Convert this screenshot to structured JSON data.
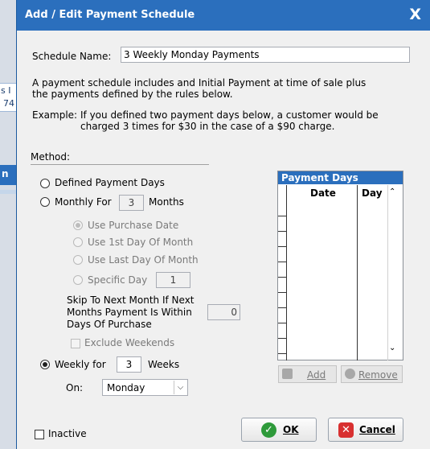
{
  "dialog": {
    "title": "Add / Edit Payment Schedule",
    "close_label": "X"
  },
  "background_fragments": [
    "s I",
    "74",
    "n"
  ],
  "schedule_name": {
    "label": "Schedule Name:",
    "value": "3 Weekly Monday Payments"
  },
  "description": {
    "line1": "A payment schedule includes and Initial Payment at time of sale plus",
    "line2": "the payments defined by the rules below.",
    "example_label": "Example:",
    "example_line1": "If you defined two payment days below, a customer would be",
    "example_line2": "charged 3 times for $30 in the case of a $90 charge."
  },
  "method": {
    "heading": "Method:",
    "defined_label": "Defined Payment Days",
    "monthly_label": "Monthly For",
    "monthly_value": "3",
    "months_suffix": "Months",
    "use_purchase_date": "Use Purchase Date",
    "use_first_day": "Use 1st Day Of Month",
    "use_last_day": "Use Last Day Of Month",
    "specific_day": "Specific Day",
    "specific_day_value": "1",
    "skip_line1": "Skip To Next Month If Next",
    "skip_line2": "Months Payment Is Within",
    "skip_line3": "Days Of Purchase",
    "skip_value": "0",
    "exclude_weekends": "Exclude Weekends",
    "weekly_label": "Weekly for",
    "weekly_value": "3",
    "weeks_suffix": "Weeks",
    "on_label": "On:",
    "on_value": "Monday",
    "on_options": [
      "Monday"
    ],
    "selected": "weekly"
  },
  "payment_days": {
    "title": "Payment Days",
    "col_date": "Date",
    "col_day": "Day",
    "add_label": "Add",
    "remove_label": "Remove"
  },
  "footer": {
    "inactive_label": "Inactive",
    "ok_label": "OK",
    "cancel_label": "Cancel"
  },
  "colors": {
    "titlebar": "#2b6fbd",
    "ok_icon": "#2e9a3a",
    "cancel_icon": "#d83030"
  }
}
